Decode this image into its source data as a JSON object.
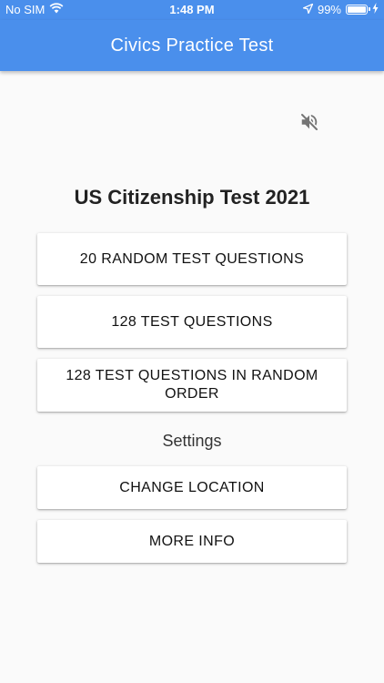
{
  "status_bar": {
    "carrier": "No SIM",
    "time": "1:48 PM",
    "battery_percent": "99%",
    "battery_level": 0.99,
    "icons": [
      "wifi-icon",
      "location-arrow-icon",
      "battery-icon",
      "charging-bolt-icon"
    ]
  },
  "app_bar": {
    "title": "Civics Practice Test",
    "color": "#4a8fec"
  },
  "sound": {
    "icon": "volume-off-icon",
    "state": "muted"
  },
  "main": {
    "title": "US Citizenship Test 2021",
    "buttons": [
      {
        "label": "20 RANDOM TEST QUESTIONS"
      },
      {
        "label": "128 TEST QUESTIONS"
      },
      {
        "label": "128 TEST QUESTIONS IN RANDOM ORDER"
      }
    ],
    "settings_label": "Settings",
    "settings_buttons": [
      {
        "label": "CHANGE LOCATION"
      },
      {
        "label": "MORE INFO"
      }
    ]
  }
}
